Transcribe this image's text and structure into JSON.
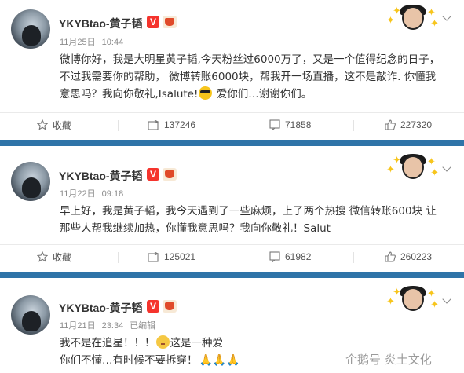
{
  "posts": [
    {
      "username": "YKYBtao-黄子韬",
      "vip_label": "V",
      "date": "11月25日",
      "time": "10:44",
      "edited": "",
      "content_line1": "微博你好，我是大明星黄子韬,今天粉丝过6000万了，又是一个值得纪念的日子，",
      "content_line2": "不过我需要你的帮助， 微博转账6000块，帮我开一场直播，这不是敲诈. 你懂我",
      "content_line3a": "意思吗？我向你敬礼,Isalute!",
      "content_line3b": "爱你们…谢谢你们。",
      "favorite_label": "收藏",
      "reposts": "137246",
      "comments": "71858",
      "likes": "227320"
    },
    {
      "username": "YKYBtao-黄子韬",
      "vip_label": "V",
      "date": "11月22日",
      "time": "09:18",
      "edited": "",
      "content_line1": "早上好，我是黄子韬，我今天遇到了一些麻烦，上了两个热搜 微信转账600块 让",
      "content_line2": "那些人帮我继续加热，你懂我意思吗？我向你敬礼！Salut",
      "favorite_label": "收藏",
      "reposts": "125021",
      "comments": "61982",
      "likes": "260223"
    },
    {
      "username": "YKYBtao-黄子韬",
      "vip_label": "V",
      "date": "11月21日",
      "time": "23:34",
      "edited": "已编辑",
      "content_line1a": "我不是在追星！！！",
      "content_line1b": "这是一种爱",
      "content_line2": "你们不懂…有时候不要拆穿！"
    }
  ],
  "watermark": "企鹅号 炎土文化",
  "colors": {
    "divider": "#2f74a8",
    "vip": "#f5342d",
    "meta": "#8c8c8c"
  },
  "icons": [
    "star-icon",
    "repost-icon",
    "comment-icon",
    "like-icon",
    "chevron-down-icon"
  ]
}
